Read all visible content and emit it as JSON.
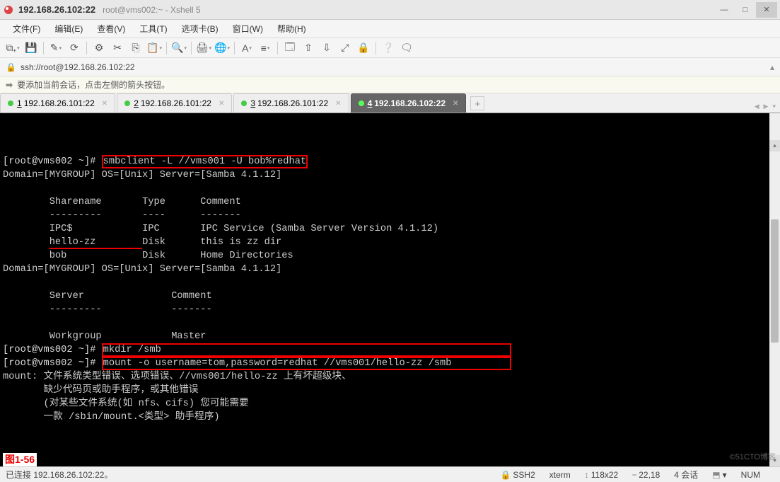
{
  "title_bar": {
    "host": "192.168.26.102:22",
    "subtitle": "root@vms002:~ - Xshell 5"
  },
  "window_controls": {
    "min": "—",
    "max": "□",
    "close": "✕"
  },
  "menu": [
    "文件(F)",
    "编辑(E)",
    "查看(V)",
    "工具(T)",
    "选项卡(B)",
    "窗口(W)",
    "帮助(H)"
  ],
  "toolbar_icons": [
    "new-session-icon",
    "save-icon",
    "sep",
    "wand-icon",
    "reconnect-icon",
    "sep",
    "settings-icon",
    "scissors-icon",
    "copy-icon",
    "paste-icon",
    "sep",
    "search-icon",
    "sep",
    "font-scale-icon",
    "encoding-icon",
    "sep",
    "highlight-icon",
    "rainbow-icon",
    "sep",
    "profile-icon",
    "upload-icon",
    "download-icon",
    "fullscreen-icon",
    "lock-icon",
    "sep",
    "help-icon",
    "chat-icon"
  ],
  "toolbar_glyphs": {
    "new-session-icon": "⧉₊",
    "save-icon": "💾",
    "wand-icon": "✎",
    "reconnect-icon": "⟳",
    "settings-icon": "⚙",
    "scissors-icon": "✂",
    "copy-icon": "⎘",
    "paste-icon": "📋",
    "search-icon": "🔍",
    "font-scale-icon": "🖨",
    "encoding-icon": "🌐",
    "highlight-icon": "A",
    "rainbow-icon": "≡",
    "profile-icon": "🗔",
    "upload-icon": "⇧",
    "download-icon": "⇩",
    "fullscreen-icon": "⤢",
    "lock-icon": "🔒",
    "help-icon": "❔",
    "chat-icon": "🗨"
  },
  "address": "ssh://root@192.168.26.102:22",
  "info_bar": "要添加当前会话，点击左侧的箭头按钮。",
  "tabs": [
    {
      "num": "1",
      "label": "192.168.26.101:22",
      "active": false
    },
    {
      "num": "2",
      "label": "192.168.26.101:22",
      "active": false
    },
    {
      "num": "3",
      "label": "192.168.26.101:22",
      "active": false
    },
    {
      "num": "4",
      "label": "192.168.26.102:22",
      "active": true
    }
  ],
  "terminal": {
    "prompt": "[root@vms002 ~]# ",
    "cmd1": "smbclient -L //vms001 -U bob%redhat",
    "out1_line1": "Domain=[MYGROUP] OS=[Unix] Server=[Samba 4.1.12]",
    "out1_blank": "",
    "shares_header": "        Sharename       Type      Comment",
    "shares_rule": "        ---------       ----      -------",
    "shares_rows": [
      {
        "name": "IPC$",
        "type": "IPC ",
        "comment": "IPC Service (Samba Server Version 4.1.12)",
        "ul_name": false
      },
      {
        "name": "hello-zz",
        "type": "Disk",
        "comment": "this is zz dir",
        "ul_name": true
      },
      {
        "name": "bob",
        "type": "Disk",
        "comment": "Home Directories",
        "ul_name": false
      }
    ],
    "out1_line2": "Domain=[MYGROUP] OS=[Unix] Server=[Samba 4.1.12]",
    "servers_header": "        Server               Comment",
    "servers_rule": "        ---------            -------",
    "workgroup_header": "        Workgroup            Master",
    "cmd2": "mkdir /smb",
    "cmd3": "mount -o username=tom,password=redhat //vms001/hello-zz /smb",
    "out3_lines": [
      "mount: 文件系统类型错误、选项错误、//vms001/hello-zz 上有坏超级块、",
      "       缺少代码页或助手程序，或其他错误",
      "       (对某些文件系统(如 nfs、cifs) 您可能需要",
      "       一款 /sbin/mount.<类型> 助手程序)"
    ]
  },
  "figure_label": "图1-56",
  "watermark": "©51CTO博客",
  "status_bar": {
    "left": "已连接 192.168.26.102:22。",
    "proto": "SSH2",
    "termtype": "xterm",
    "size": "118x22",
    "cursor": "22,18",
    "sess": "4 会话",
    "ctrl_dot": "⬒",
    "nlabel": "NUM"
  }
}
